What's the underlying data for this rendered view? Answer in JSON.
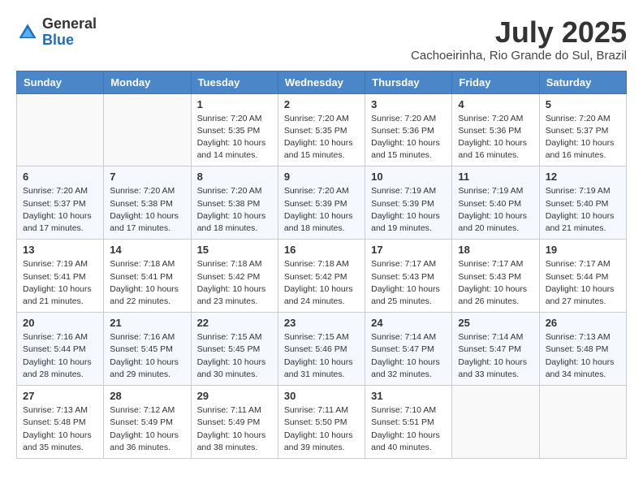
{
  "header": {
    "logo_general": "General",
    "logo_blue": "Blue",
    "month_title": "July 2025",
    "subtitle": "Cachoeirinha, Rio Grande do Sul, Brazil"
  },
  "weekdays": [
    "Sunday",
    "Monday",
    "Tuesday",
    "Wednesday",
    "Thursday",
    "Friday",
    "Saturday"
  ],
  "weeks": [
    [
      {
        "day": "",
        "info": ""
      },
      {
        "day": "",
        "info": ""
      },
      {
        "day": "1",
        "info": "Sunrise: 7:20 AM\nSunset: 5:35 PM\nDaylight: 10 hours and 14 minutes."
      },
      {
        "day": "2",
        "info": "Sunrise: 7:20 AM\nSunset: 5:35 PM\nDaylight: 10 hours and 15 minutes."
      },
      {
        "day": "3",
        "info": "Sunrise: 7:20 AM\nSunset: 5:36 PM\nDaylight: 10 hours and 15 minutes."
      },
      {
        "day": "4",
        "info": "Sunrise: 7:20 AM\nSunset: 5:36 PM\nDaylight: 10 hours and 16 minutes."
      },
      {
        "day": "5",
        "info": "Sunrise: 7:20 AM\nSunset: 5:37 PM\nDaylight: 10 hours and 16 minutes."
      }
    ],
    [
      {
        "day": "6",
        "info": "Sunrise: 7:20 AM\nSunset: 5:37 PM\nDaylight: 10 hours and 17 minutes."
      },
      {
        "day": "7",
        "info": "Sunrise: 7:20 AM\nSunset: 5:38 PM\nDaylight: 10 hours and 17 minutes."
      },
      {
        "day": "8",
        "info": "Sunrise: 7:20 AM\nSunset: 5:38 PM\nDaylight: 10 hours and 18 minutes."
      },
      {
        "day": "9",
        "info": "Sunrise: 7:20 AM\nSunset: 5:39 PM\nDaylight: 10 hours and 18 minutes."
      },
      {
        "day": "10",
        "info": "Sunrise: 7:19 AM\nSunset: 5:39 PM\nDaylight: 10 hours and 19 minutes."
      },
      {
        "day": "11",
        "info": "Sunrise: 7:19 AM\nSunset: 5:40 PM\nDaylight: 10 hours and 20 minutes."
      },
      {
        "day": "12",
        "info": "Sunrise: 7:19 AM\nSunset: 5:40 PM\nDaylight: 10 hours and 21 minutes."
      }
    ],
    [
      {
        "day": "13",
        "info": "Sunrise: 7:19 AM\nSunset: 5:41 PM\nDaylight: 10 hours and 21 minutes."
      },
      {
        "day": "14",
        "info": "Sunrise: 7:18 AM\nSunset: 5:41 PM\nDaylight: 10 hours and 22 minutes."
      },
      {
        "day": "15",
        "info": "Sunrise: 7:18 AM\nSunset: 5:42 PM\nDaylight: 10 hours and 23 minutes."
      },
      {
        "day": "16",
        "info": "Sunrise: 7:18 AM\nSunset: 5:42 PM\nDaylight: 10 hours and 24 minutes."
      },
      {
        "day": "17",
        "info": "Sunrise: 7:17 AM\nSunset: 5:43 PM\nDaylight: 10 hours and 25 minutes."
      },
      {
        "day": "18",
        "info": "Sunrise: 7:17 AM\nSunset: 5:43 PM\nDaylight: 10 hours and 26 minutes."
      },
      {
        "day": "19",
        "info": "Sunrise: 7:17 AM\nSunset: 5:44 PM\nDaylight: 10 hours and 27 minutes."
      }
    ],
    [
      {
        "day": "20",
        "info": "Sunrise: 7:16 AM\nSunset: 5:44 PM\nDaylight: 10 hours and 28 minutes."
      },
      {
        "day": "21",
        "info": "Sunrise: 7:16 AM\nSunset: 5:45 PM\nDaylight: 10 hours and 29 minutes."
      },
      {
        "day": "22",
        "info": "Sunrise: 7:15 AM\nSunset: 5:45 PM\nDaylight: 10 hours and 30 minutes."
      },
      {
        "day": "23",
        "info": "Sunrise: 7:15 AM\nSunset: 5:46 PM\nDaylight: 10 hours and 31 minutes."
      },
      {
        "day": "24",
        "info": "Sunrise: 7:14 AM\nSunset: 5:47 PM\nDaylight: 10 hours and 32 minutes."
      },
      {
        "day": "25",
        "info": "Sunrise: 7:14 AM\nSunset: 5:47 PM\nDaylight: 10 hours and 33 minutes."
      },
      {
        "day": "26",
        "info": "Sunrise: 7:13 AM\nSunset: 5:48 PM\nDaylight: 10 hours and 34 minutes."
      }
    ],
    [
      {
        "day": "27",
        "info": "Sunrise: 7:13 AM\nSunset: 5:48 PM\nDaylight: 10 hours and 35 minutes."
      },
      {
        "day": "28",
        "info": "Sunrise: 7:12 AM\nSunset: 5:49 PM\nDaylight: 10 hours and 36 minutes."
      },
      {
        "day": "29",
        "info": "Sunrise: 7:11 AM\nSunset: 5:49 PM\nDaylight: 10 hours and 38 minutes."
      },
      {
        "day": "30",
        "info": "Sunrise: 7:11 AM\nSunset: 5:50 PM\nDaylight: 10 hours and 39 minutes."
      },
      {
        "day": "31",
        "info": "Sunrise: 7:10 AM\nSunset: 5:51 PM\nDaylight: 10 hours and 40 minutes."
      },
      {
        "day": "",
        "info": ""
      },
      {
        "day": "",
        "info": ""
      }
    ]
  ]
}
